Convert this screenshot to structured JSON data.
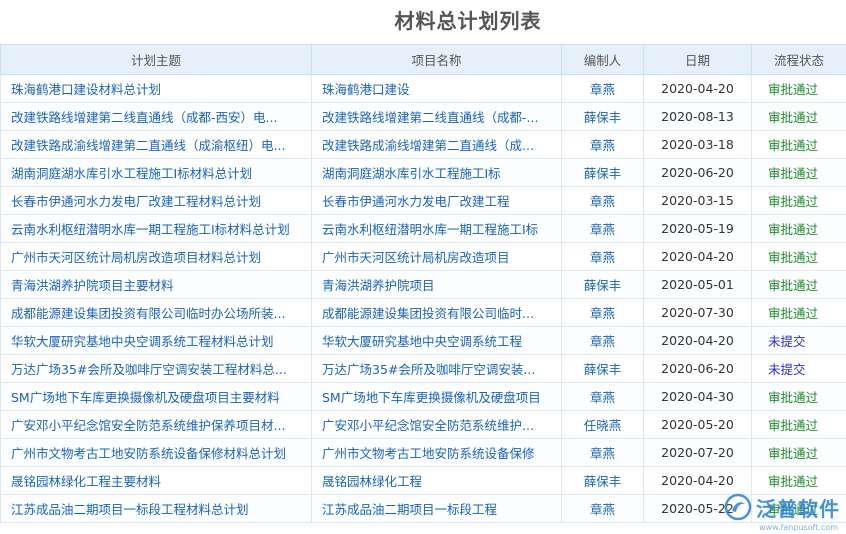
{
  "title": "材料总计划列表",
  "columns": [
    "计划主题",
    "项目名称",
    "编制人",
    "日期",
    "流程状态"
  ],
  "rows": [
    {
      "subject": "珠海鹤港口建设材料总计划",
      "project": "珠海鹤港口建设",
      "author": "章燕",
      "date": "2020-04-20",
      "status": "审批通过"
    },
    {
      "subject": "改建铁路线增建第二线直通线（成都-西安）电...",
      "project": "改建铁路线增建第二线直通线（成都-...",
      "author": "薛保丰",
      "date": "2020-08-13",
      "status": "审批通过"
    },
    {
      "subject": "改建铁路成渝线增建第二直通线（成渝枢纽）电...",
      "project": "改建铁路成渝线增建第二直通线（成...",
      "author": "章燕",
      "date": "2020-03-18",
      "status": "审批通过"
    },
    {
      "subject": "湖南洞庭湖水库引水工程施工I标材料总计划",
      "project": "湖南洞庭湖水库引水工程施工I标",
      "author": "薛保丰",
      "date": "2020-06-20",
      "status": "审批通过"
    },
    {
      "subject": "长春市伊通河水力发电厂改建工程材料总计划",
      "project": "长春市伊通河水力发电厂改建工程",
      "author": "章燕",
      "date": "2020-03-15",
      "status": "审批通过"
    },
    {
      "subject": "云南水利枢纽潜明水库一期工程施工I标材料总计划",
      "project": "云南水利枢纽潜明水库一期工程施工I标",
      "author": "章燕",
      "date": "2020-05-19",
      "status": "审批通过"
    },
    {
      "subject": "广州市天河区统计局机房改造项目材料总计划",
      "project": "广州市天河区统计局机房改造项目",
      "author": "章燕",
      "date": "2020-04-20",
      "status": "审批通过"
    },
    {
      "subject": "青海洪湖养护院项目主要材料",
      "project": "青海洪湖养护院项目",
      "author": "薛保丰",
      "date": "2020-05-01",
      "status": "审批通过"
    },
    {
      "subject": "成都能源建设集团投资有限公司临时办公场所装...",
      "project": "成都能源建设集团投资有限公司临时...",
      "author": "章燕",
      "date": "2020-07-30",
      "status": "审批通过"
    },
    {
      "subject": "华软大厦研究基地中央空调系统工程材料总计划",
      "project": "华软大厦研究基地中央空调系统工程",
      "author": "章燕",
      "date": "2020-04-20",
      "status": "未提交"
    },
    {
      "subject": "万达广场35#会所及咖啡厅空调安装工程材料总...",
      "project": "万达广场35#会所及咖啡厅空调安装...",
      "author": "薛保丰",
      "date": "2020-06-20",
      "status": "未提交"
    },
    {
      "subject": "SM广场地下车库更换摄像机及硬盘项目主要材料",
      "project": "SM广场地下车库更换摄像机及硬盘项目",
      "author": "章燕",
      "date": "2020-04-30",
      "status": "审批通过"
    },
    {
      "subject": "广安邓小平纪念馆安全防范系统维护保养项目材...",
      "project": "广安邓小平纪念馆安全防范系统维护...",
      "author": "任晓燕",
      "date": "2020-05-20",
      "status": "审批通过"
    },
    {
      "subject": "广州市文物考古工地安防系统设备保修材料总计划",
      "project": "广州市文物考古工地安防系统设备保修",
      "author": "章燕",
      "date": "2020-07-20",
      "status": "审批通过"
    },
    {
      "subject": "晟铭园林绿化工程主要材料",
      "project": "晟铭园林绿化工程",
      "author": "薛保丰",
      "date": "2020-04-20",
      "status": "审批通过"
    },
    {
      "subject": "江苏成品油二期项目一标段工程材料总计划",
      "project": "江苏成品油二期项目一标段工程",
      "author": "章燕",
      "date": "2020-05-22",
      "status": "审批通过"
    }
  ],
  "status_colors": {
    "审批通过": "#1f8a2b",
    "未提交": "#2b2bd6"
  },
  "watermark": {
    "text": "泛普软件",
    "sub": "www.fanpusoft.com",
    "icon": "fanpu-logo-icon"
  }
}
